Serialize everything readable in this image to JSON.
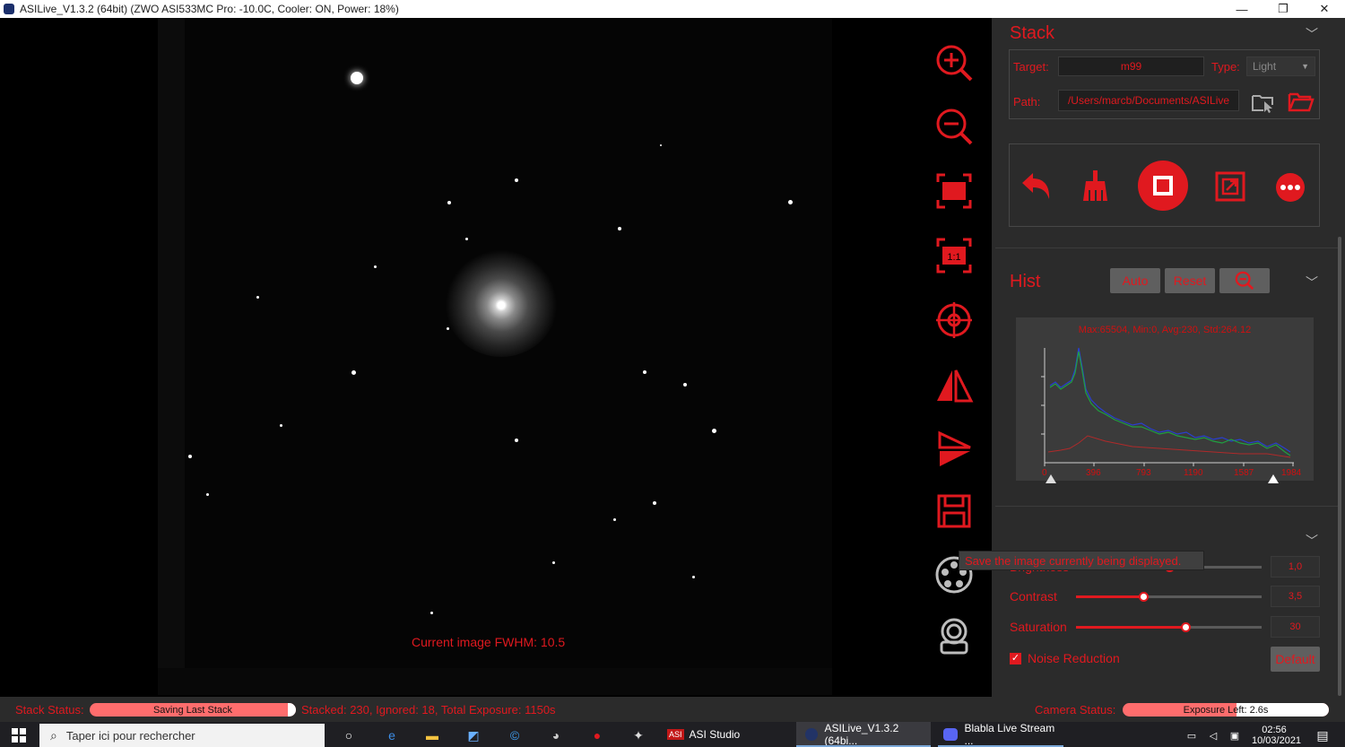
{
  "window": {
    "title": "ASILive_V1.3.2 (64bit)  (ZWO ASI533MC Pro: -10.0C, Cooler: ON, Power: 18%)",
    "minimize": "—",
    "maximize": "❐",
    "close": "✕"
  },
  "image": {
    "fwhm_text": "Current image FWHM: 10.5"
  },
  "toolbar_icons": [
    "zoom-in-icon",
    "zoom-out-icon",
    "fit-screen-icon",
    "actual-size-icon",
    "crosshair-icon",
    "flip-horizontal-icon",
    "flip-vertical-icon",
    "save-icon",
    "filter-wheel-icon",
    "camera-icon"
  ],
  "stack": {
    "title": "Stack",
    "target_label": "Target:",
    "target_value": "m99",
    "type_label": "Type:",
    "type_value": "Light",
    "path_label": "Path:",
    "path_value": "/Users/marcb/Documents/ASILive",
    "controls": [
      "undo-icon",
      "clean-icon",
      "stop-icon",
      "export-icon",
      "more-icon"
    ]
  },
  "hist": {
    "title": "Hist",
    "auto": "Auto",
    "reset": "Reset",
    "stats": "Max:65504, Min:0, Avg:230, Std:264.12",
    "ticks": [
      "0",
      "396",
      "793",
      "1190",
      "1587",
      "1984"
    ]
  },
  "adjust": {
    "tooltip": "Save the image currently being displayed.",
    "brightness_label": "Brightness",
    "brightness_value": "1,0",
    "brightness_level": 0.5,
    "contrast_label": "Contrast",
    "contrast_value": "3,5",
    "contrast_level": 0.36,
    "saturation_label": "Saturation",
    "saturation_value": "30",
    "saturation_level": 0.59,
    "noise_reduction_label": "Noise Reduction",
    "noise_reduction_checked": true,
    "default_label": "Default"
  },
  "status": {
    "stack_status_label": "Stack Status:",
    "stack_status_text": "Saving Last Stack",
    "stack_progress": 0.96,
    "stack_info": "Stacked: 230, Ignored: 18, Total Exposure: 1150s",
    "camera_status_label": "Camera Status:",
    "camera_status_text": "Exposure Left: 2.6s",
    "camera_progress": 0.55
  },
  "taskbar": {
    "search_placeholder": "Taper ici pour rechercher",
    "apps": [
      "ASI Studio",
      "ASILive_V1.3.2 (64bi...",
      "Blabla Live Stream ..."
    ],
    "time": "02:56",
    "date": "10/03/2021"
  },
  "colors": {
    "accent": "#e0191f",
    "panel": "#2b2b2b"
  }
}
